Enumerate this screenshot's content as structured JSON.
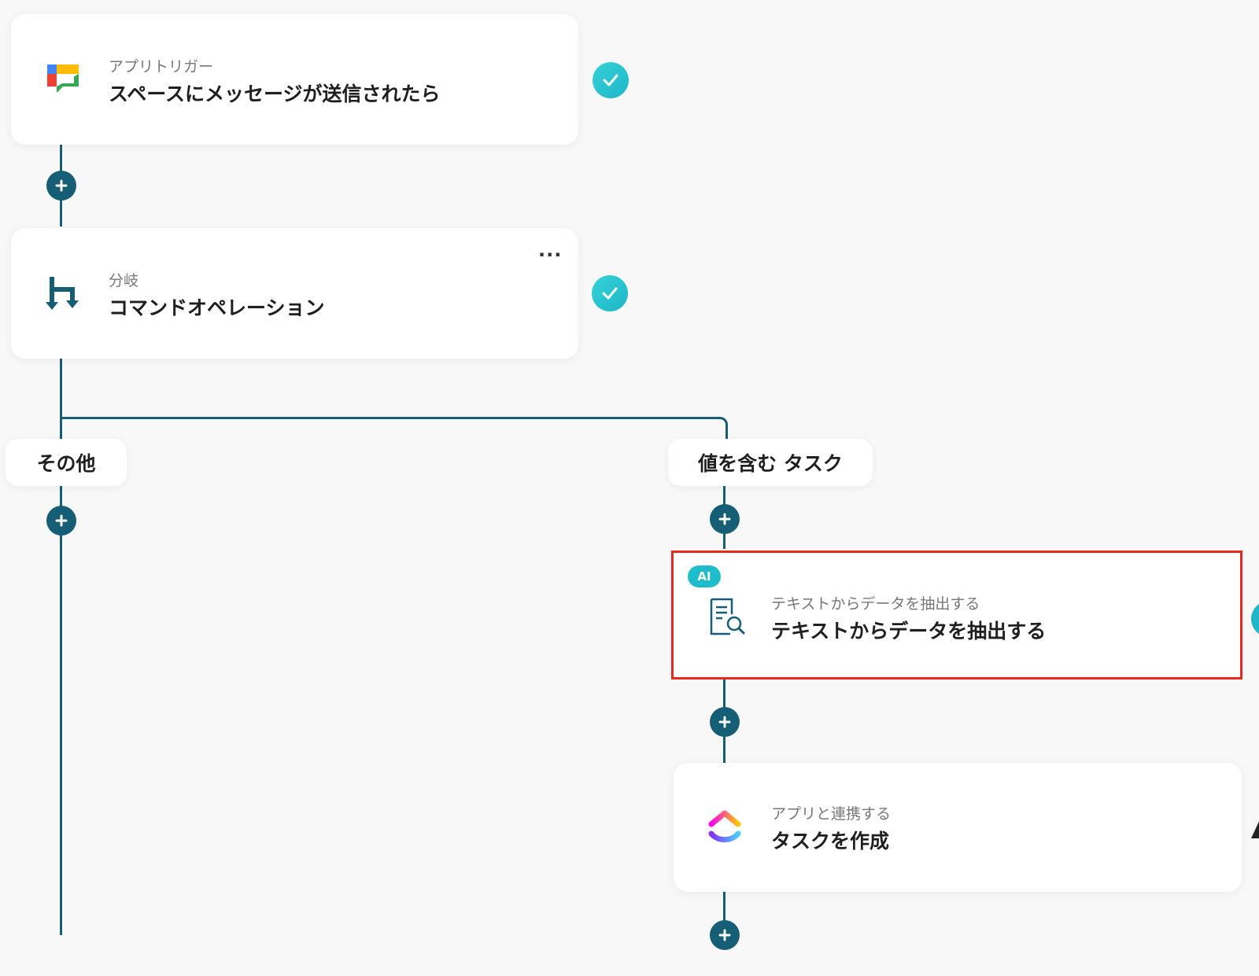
{
  "steps": [
    {
      "subtitle": "アプリトリガー",
      "title": "スペースにメッセージが送信されたら",
      "icon": "google-chat-icon",
      "status": "check-icon"
    },
    {
      "subtitle": "分岐",
      "title": "コマンドオペレーション",
      "icon": "branch-icon",
      "status": "check-icon",
      "menu": "..."
    },
    {
      "subtitle": "テキストからデータを抽出する",
      "title": "テキストからデータを抽出する",
      "icon": "document-search-icon",
      "badge": "AI",
      "highlight_color": "#e62a1e"
    },
    {
      "subtitle": "アプリと連携する",
      "title": "タスクを作成",
      "icon": "clickup-icon"
    }
  ],
  "branches": [
    {
      "label": "その他"
    },
    {
      "label": "値を含む タスク"
    }
  ],
  "colors": {
    "connector": "#155e75",
    "check": "#1fb6c8",
    "ai_badge": "#1fbccb",
    "highlight": "#e62a1e"
  }
}
